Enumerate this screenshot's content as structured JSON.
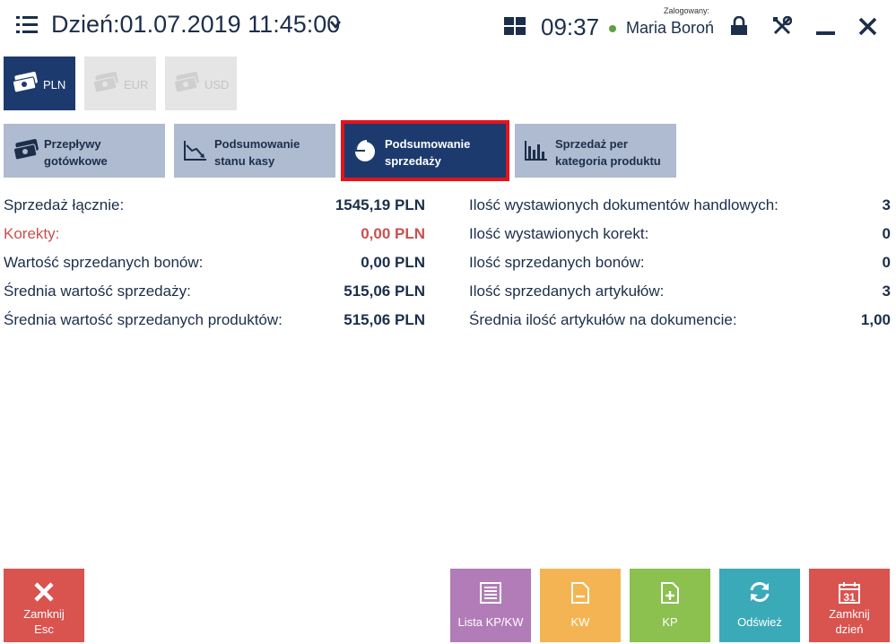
{
  "header": {
    "day_label": "Dzień:01.07.2019 11:45:00",
    "clock": "09:37",
    "logged_label": "Zalogowany:",
    "user_name": "Maria Boroń"
  },
  "currencies": [
    {
      "label": "PLN",
      "active": true
    },
    {
      "label": "EUR",
      "active": false
    },
    {
      "label": "USD",
      "active": false
    }
  ],
  "tabs": [
    {
      "line1": "Przepływy",
      "line2": "gotówkowe"
    },
    {
      "line1": "Podsumowanie",
      "line2": "stanu kasy"
    },
    {
      "line1": "Podsumowanie",
      "line2": "sprzedaży"
    },
    {
      "line1": "Sprzedaż per",
      "line2": "kategoria produktu"
    }
  ],
  "stats_left": [
    {
      "label": "Sprzedaż łącznie:",
      "value": "1545,19 PLN"
    },
    {
      "label": "Korekty:",
      "value": "0,00 PLN"
    },
    {
      "label": "Wartość sprzedanych bonów:",
      "value": "0,00 PLN"
    },
    {
      "label": "Średnia wartość sprzedaży:",
      "value": "515,06 PLN"
    },
    {
      "label": "Średnia wartość sprzedanych produktów:",
      "value": "515,06 PLN"
    }
  ],
  "stats_right": [
    {
      "label": "Ilość wystawionych dokumentów handlowych:",
      "value": "3"
    },
    {
      "label": "Ilość wystawionych korekt:",
      "value": "0"
    },
    {
      "label": "Ilość sprzedanych bonów:",
      "value": "0"
    },
    {
      "label": "Ilość sprzedanych artykułów:",
      "value": "3"
    },
    {
      "label": "Średnia ilość artykułów na dokumencie:",
      "value": "1,00"
    }
  ],
  "bottom_buttons": {
    "close": {
      "line1": "Zamknij",
      "line2": "Esc"
    },
    "list": {
      "label": "Lista KP/KW"
    },
    "kw": {
      "label": "KW"
    },
    "kp": {
      "label": "KP"
    },
    "refresh": {
      "label": "Odśwież"
    },
    "close_day": {
      "line1": "Zamknij",
      "line2": "dzień",
      "calendar_day": "31"
    }
  },
  "colors": {
    "navy": "#1c3a6e",
    "tab_inactive": "#aebbd0",
    "active_outline": "#e3141b",
    "correction_red": "#c9504e",
    "close_btn": "#d9534f",
    "list_btn": "#b27cb8",
    "kw_btn": "#f5b453",
    "kp_btn": "#8cc04f",
    "refresh_btn": "#3aaab8",
    "close_day_btn": "#d9534f"
  }
}
